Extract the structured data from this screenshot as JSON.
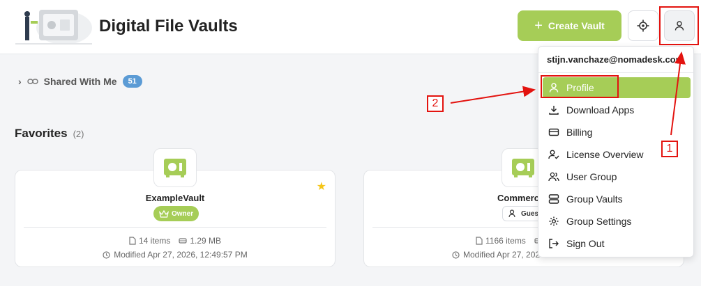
{
  "header": {
    "title": "Digital File Vaults",
    "create_label": "Create Vault"
  },
  "shared": {
    "label": "Shared With Me",
    "count": "51"
  },
  "favorites": {
    "title": "Favorites",
    "count": "(2)",
    "cards": [
      {
        "name": "ExampleVault",
        "role": "Owner",
        "items": "14 items",
        "size": "1.29 MB",
        "modified": "Modified Apr 27, 2026, 12:49:57 PM"
      },
      {
        "name": "Commerc",
        "role": "Guest",
        "items": "1166 items",
        "size": "",
        "modified": "Modified Apr 27, 202"
      }
    ]
  },
  "user_menu": {
    "email": "stijn.vanchaze@nomadesk.com",
    "items": [
      {
        "label": "Profile",
        "icon": "user-icon"
      },
      {
        "label": "Download Apps",
        "icon": "download-icon"
      },
      {
        "label": "Billing",
        "icon": "credit-card-icon"
      },
      {
        "label": "License Overview",
        "icon": "user-check-icon"
      },
      {
        "label": "User Group",
        "icon": "users-icon"
      },
      {
        "label": "Group Vaults",
        "icon": "server-icon"
      },
      {
        "label": "Group Settings",
        "icon": "gear-icon"
      },
      {
        "label": "Sign Out",
        "icon": "sign-out-icon"
      }
    ]
  },
  "annotations": {
    "label_1": "1",
    "label_2": "2"
  },
  "colors": {
    "accent": "#a6cd57",
    "badge": "#5b9bd5",
    "annotation": "#e3130f",
    "star": "#f5c518"
  }
}
